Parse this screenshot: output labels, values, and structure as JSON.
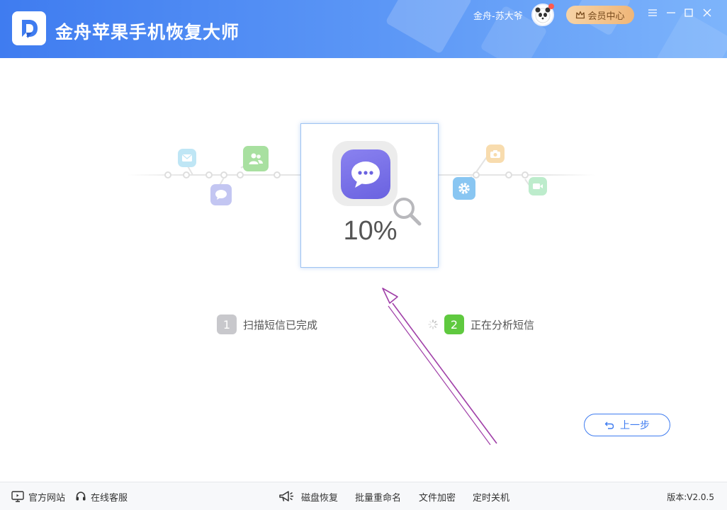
{
  "header": {
    "app_title": "金舟苹果手机恢复大师",
    "user_name": "金舟-苏大爷",
    "vip_label": "会员中心",
    "brand_color": "#3f7cf0"
  },
  "window_controls": {
    "menu_icon": "menu-icon",
    "minimize_icon": "minimize-icon",
    "maximize_icon": "maximize-icon",
    "close_icon": "close-icon"
  },
  "scan": {
    "progress_percent": 10,
    "progress_label": "10%",
    "center_icon": "message-bubble-icon"
  },
  "feature_icons": [
    {
      "name": "mail-icon",
      "color": "#bfe6f5"
    },
    {
      "name": "contacts-icon",
      "color": "#a8e0a0"
    },
    {
      "name": "chat-icon",
      "color": "#c3c6f2"
    },
    {
      "name": "camera-icon",
      "color": "#f8dcae"
    },
    {
      "name": "settings-icon",
      "color": "#89c6f2"
    },
    {
      "name": "video-icon",
      "color": "#bdeccc"
    }
  ],
  "steps": [
    {
      "number": "1",
      "label": "扫描短信已完成",
      "status": "done",
      "color": "#c8c8cc"
    },
    {
      "number": "2",
      "label": "正在分析短信",
      "status": "in-progress",
      "color": "#5fc93f"
    }
  ],
  "actions": {
    "back_label": "上一步"
  },
  "footer": {
    "website_label": "官方网站",
    "support_label": "在线客服",
    "links": [
      "磁盘恢复",
      "批量重命名",
      "文件加密",
      "定时关机"
    ],
    "version": "版本:V2.0.5"
  }
}
